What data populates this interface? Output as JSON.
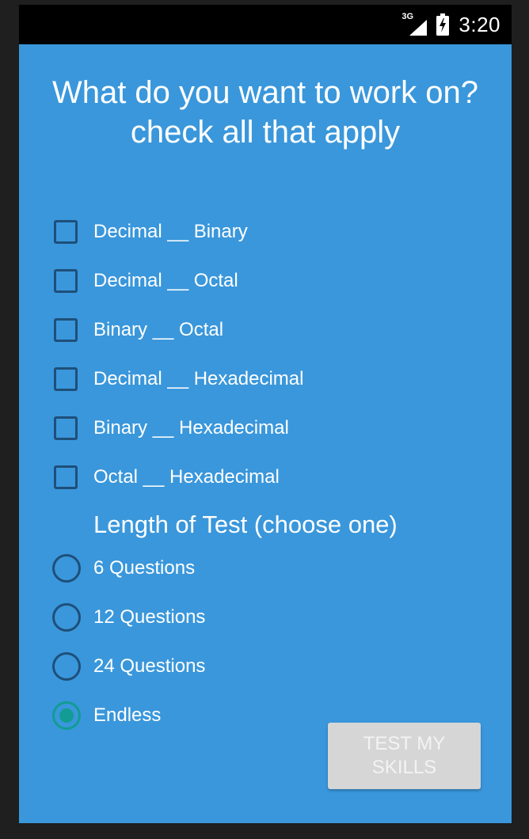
{
  "status_bar": {
    "network_type": "3G",
    "time": "3:20",
    "icons": [
      "signal-icon",
      "battery-charging-icon"
    ]
  },
  "colors": {
    "background": "#3a97db",
    "control_border": "#1e4f7a",
    "radio_selected": "#129c93",
    "button_background": "#d6d6d6",
    "button_text": "#f3f3f3"
  },
  "screen": {
    "title": "What do you want to work on? check all that apply",
    "conversions": [
      {
        "label": "Decimal __ Binary",
        "checked": false
      },
      {
        "label": "Decimal __ Octal",
        "checked": false
      },
      {
        "label": "Binary __ Octal",
        "checked": false
      },
      {
        "label": "Decimal __ Hexadecimal",
        "checked": false
      },
      {
        "label": "Binary __ Hexadecimal",
        "checked": false
      },
      {
        "label": "Octal __ Hexadecimal",
        "checked": false
      }
    ],
    "length_title": "Length of Test (choose one)",
    "lengths": [
      {
        "label": "6 Questions",
        "selected": false
      },
      {
        "label": "12 Questions",
        "selected": false
      },
      {
        "label": "24 Questions",
        "selected": false
      },
      {
        "label": "Endless",
        "selected": true
      }
    ],
    "submit_label": "TEST MY SKILLS"
  }
}
